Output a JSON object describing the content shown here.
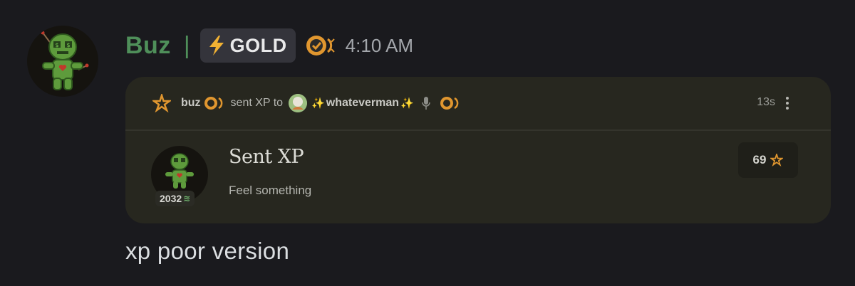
{
  "author": {
    "name": "Buz",
    "separator": "|",
    "role_tag": "GOLD",
    "timestamp": "4:10 AM",
    "avatar_icon": "voodoo-doll-avatar"
  },
  "embed": {
    "sender": "buz",
    "action": "sent XP to",
    "recipient": "whateverman",
    "recipient_sparkle_left": "✨",
    "recipient_sparkle_right": "✨",
    "time_ago": "13s",
    "title": "Sent XP",
    "subtitle": "Feel something",
    "level": "2032",
    "level_icon": "≋",
    "amount": "69"
  },
  "message": {
    "text": "xp poor version"
  },
  "colors": {
    "background": "#1a1a1e",
    "username": "#4f8f5a",
    "embed_bg": "#27271f",
    "accent_orange": "#e0962f"
  }
}
